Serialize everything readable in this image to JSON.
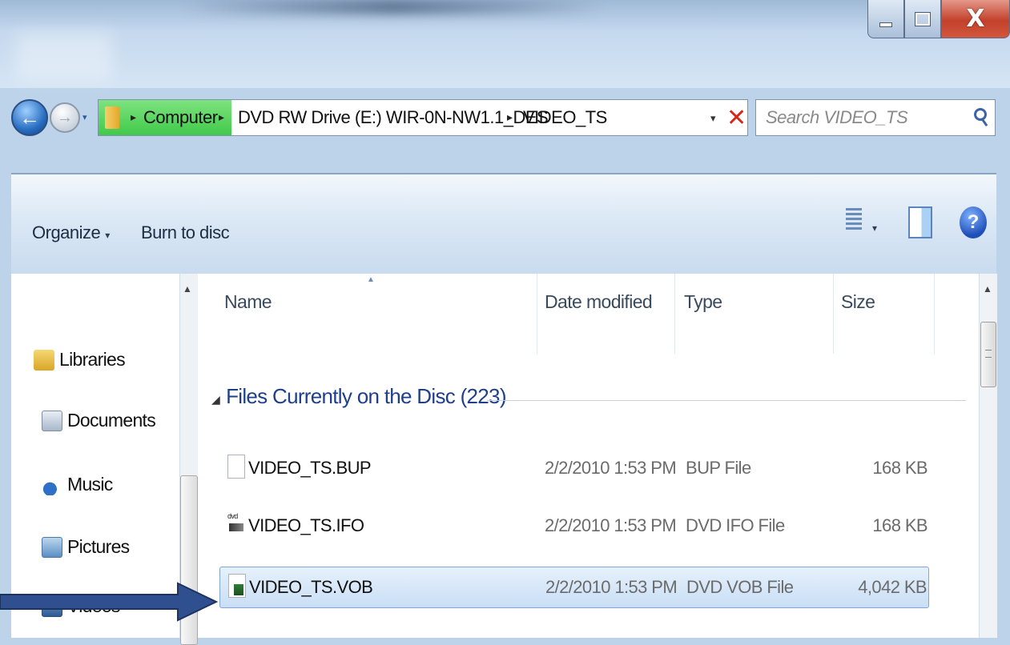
{
  "window": {
    "controls": {
      "minimize_icon": "minimize-icon",
      "maximize_icon": "maximize-icon",
      "close_label": "X"
    }
  },
  "nav": {
    "back_glyph": "←",
    "forward_glyph": "→",
    "history_dropdown_glyph": "▾"
  },
  "address": {
    "segments": [
      "Computer",
      "DVD RW Drive (E:) WIR-0N-NW1.1_DES",
      "VIDEO_TS"
    ],
    "separator": "▸",
    "dropdown_glyph": "▾",
    "clear_glyph": "✕"
  },
  "search": {
    "placeholder": "Search VIDEO_TS"
  },
  "toolbar": {
    "organize_label": "Organize",
    "organize_arrow": "▾",
    "burn_label": "Burn to disc",
    "views_dropdown": "▾",
    "help_glyph": "?"
  },
  "sidebar": {
    "items": [
      {
        "label": "Libraries",
        "icon": "libraries-icon"
      },
      {
        "label": "Documents",
        "icon": "documents-icon"
      },
      {
        "label": "Music",
        "icon": "music-icon"
      },
      {
        "label": "Pictures",
        "icon": "pictures-icon"
      },
      {
        "label": "Videos",
        "icon": "videos-icon"
      }
    ],
    "scroll_up_glyph": "▲"
  },
  "filelist": {
    "columns": [
      "Name",
      "Date modified",
      "Type",
      "Size"
    ],
    "sort_glyph": "▲",
    "group": {
      "label": "Files Currently on the Disc (223)",
      "toggle_glyph": "◢"
    },
    "rows": [
      {
        "name": "VIDEO_TS.BUP",
        "date": "2/2/2010 1:53 PM",
        "type": "BUP File",
        "size": "168 KB",
        "icon": "bup-file-icon"
      },
      {
        "name": "VIDEO_TS.IFO",
        "date": "2/2/2010 1:53 PM",
        "type": "DVD IFO File",
        "size": "168 KB",
        "icon": "dvd-ifo-file-icon"
      },
      {
        "name": "VIDEO_TS.VOB",
        "date": "2/2/2010 1:53 PM",
        "type": "DVD VOB File",
        "size": "4,042 KB",
        "icon": "dvd-vob-file-icon",
        "selected": true
      }
    ],
    "scroll_up_glyph": "▲"
  },
  "colors": {
    "accent": "#1e3f8c",
    "selection": "#c9def5",
    "annotation_arrow": "#2f4f8f",
    "close_button": "#c2412b"
  }
}
